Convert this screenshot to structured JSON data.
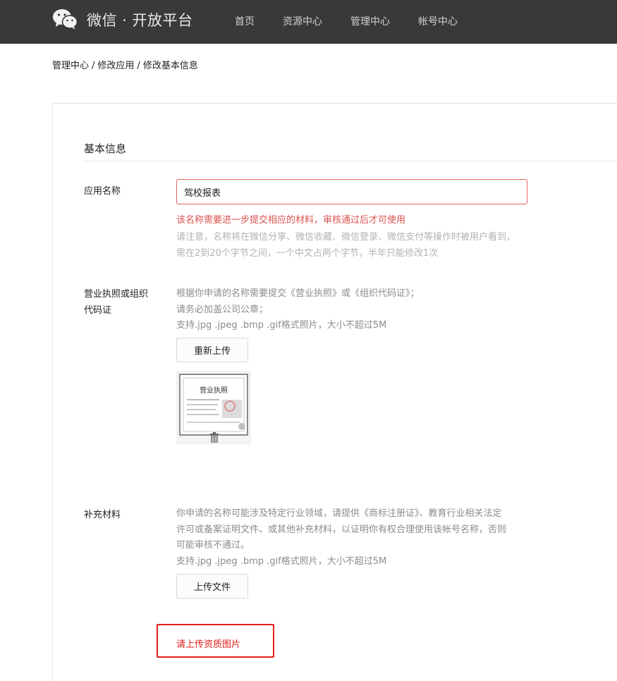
{
  "header": {
    "brand": "微信 · 开放平台",
    "nav": [
      {
        "label": "首页"
      },
      {
        "label": "资源中心"
      },
      {
        "label": "管理中心"
      },
      {
        "label": "帐号中心"
      }
    ]
  },
  "breadcrumb": {
    "items": [
      "管理中心",
      "修改应用",
      "修改基本信息"
    ],
    "separator": "/"
  },
  "section": {
    "title": "基本信息"
  },
  "app_name": {
    "label": "应用名称",
    "value": "驾校报表",
    "error": "该名称需要进一步提交相应的材料，审核通过后才可使用",
    "tips": [
      "请注意，名称将在微信分享、微信收藏、微信登录、微信支付等操作时被用户看到，",
      "需在2到20个字节之间，一个中文占两个字节，半年只能修改1次"
    ]
  },
  "license": {
    "label_lines": [
      "营业执照或组织",
      "代码证"
    ],
    "tips": [
      "根据你申请的名称需要提交《营业执照》或《组织代码证》；",
      "请务必加盖公司公章；",
      "支持.jpg .jpeg .bmp .gif格式照片，大小不超过5M"
    ],
    "reupload_label": "重新上传",
    "thumbnail_title": "营业执照"
  },
  "supplement": {
    "label": "补充材料",
    "tips": [
      "你申请的名称可能涉及特定行业领域，请提供《商标注册证》、教育行业相关法定",
      "许可或备案证明文件、或其他补充材料，以证明你有权合理使用该帐号名称，否则",
      "可能审核不通过。",
      "支持.jpg .jpeg .bmp .gif格式照片，大小不超过5M"
    ],
    "upload_label": "上传文件",
    "warning": "请上传资质图片"
  },
  "colors": {
    "header_bg": "#393939",
    "error_red": "#d9534f",
    "annotation_red": "#e0201a"
  }
}
